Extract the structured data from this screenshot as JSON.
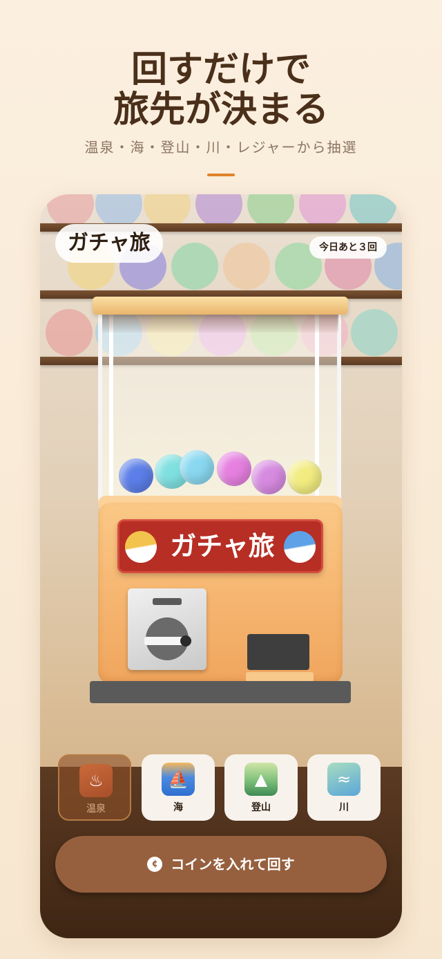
{
  "headline": {
    "line1": "回すだけで",
    "line2": "旅先が決まる"
  },
  "subline": "温泉・海・登山・川・レジャーから抽選",
  "app": {
    "title": "ガチャ旅",
    "remaining": "今日あと３回"
  },
  "machine": {
    "label": "ガチャ旅"
  },
  "categories": [
    {
      "label": "温泉",
      "icon": "hot-spring-icon",
      "selected": true
    },
    {
      "label": "海",
      "icon": "sailboat-icon",
      "selected": false
    },
    {
      "label": "登山",
      "icon": "mountain-icon",
      "selected": false
    },
    {
      "label": "川",
      "icon": "river-icon",
      "selected": false
    }
  ],
  "spin_button": {
    "icon": "coin-icon",
    "icon_glyph": "¢",
    "label": "コインを入れて回す"
  },
  "colors": {
    "accent": "#e0822a",
    "button": "#96603e",
    "label_plate": "#b62e24"
  }
}
